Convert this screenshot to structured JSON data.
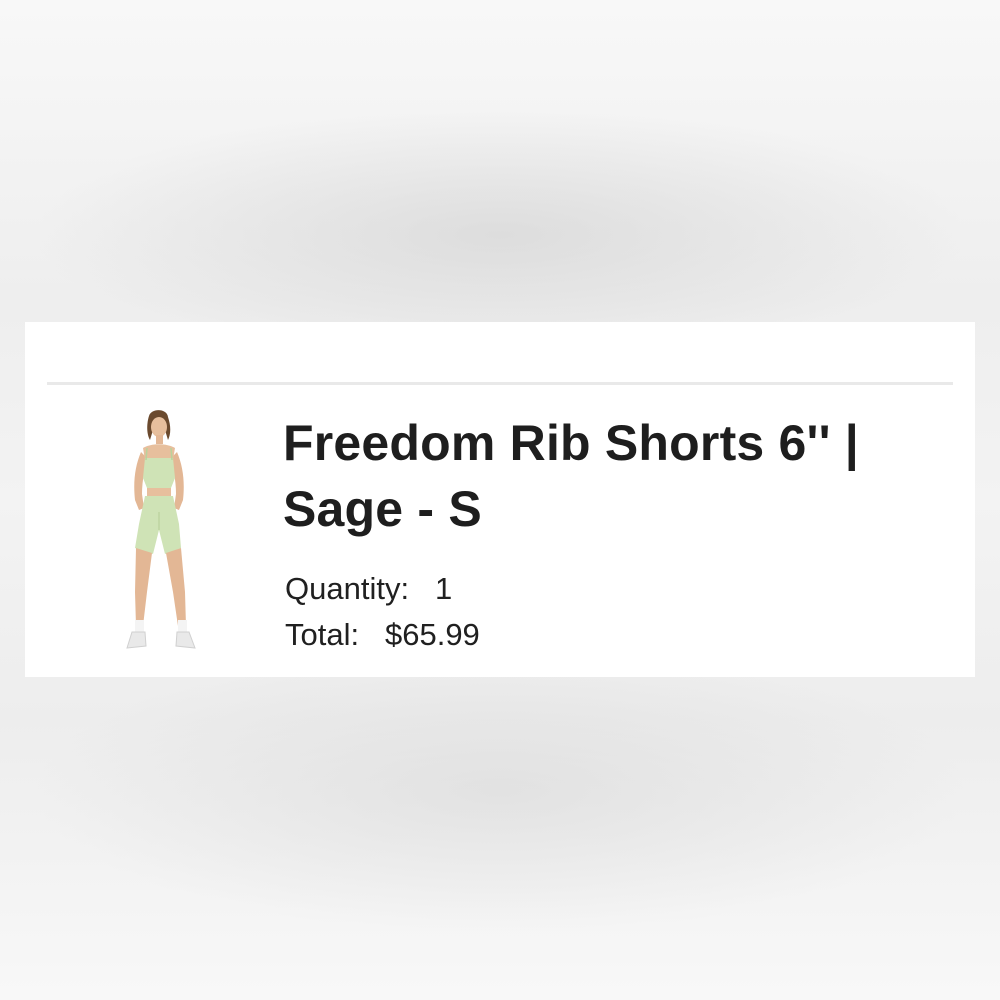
{
  "order_item": {
    "image_alt": "Model wearing sage rib shorts and crop top",
    "title": "Freedom Rib Shorts 6'' | Sage - S",
    "quantity_label": "Quantity:",
    "quantity_value": "1",
    "total_label": "Total:",
    "total_value": "$65.99"
  },
  "colors": {
    "garment": "#cfe3b6",
    "text": "#1e1e1e",
    "divider": "#e9e9e9",
    "card": "#ffffff"
  }
}
